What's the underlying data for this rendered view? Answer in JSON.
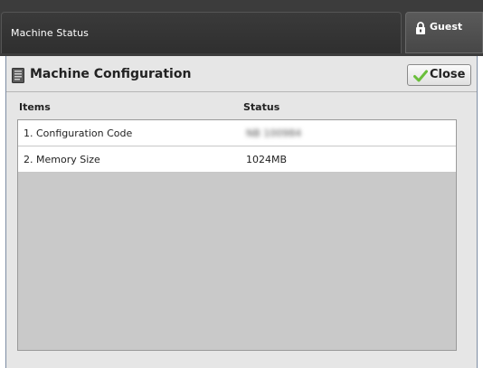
{
  "topbar": {
    "title": "Machine Status",
    "user_label": "Guest",
    "user_icon": "padlock-user-icon"
  },
  "panel": {
    "title": "Machine Configuration",
    "title_icon": "document-icon",
    "close_label": "Close",
    "close_icon": "checkmark-icon"
  },
  "table": {
    "columns": [
      "Items",
      "Status"
    ],
    "rows": [
      {
        "item": "1. Configuration Code",
        "status": "NB 100984"
      },
      {
        "item": "2. Memory Size",
        "status": "1024MB"
      }
    ]
  },
  "colors": {
    "topbar_bg": "#3c3c3c",
    "panel_bg": "#e6e6e6",
    "table_empty_bg": "#c9c9c9",
    "check_green": "#6abf3b"
  }
}
